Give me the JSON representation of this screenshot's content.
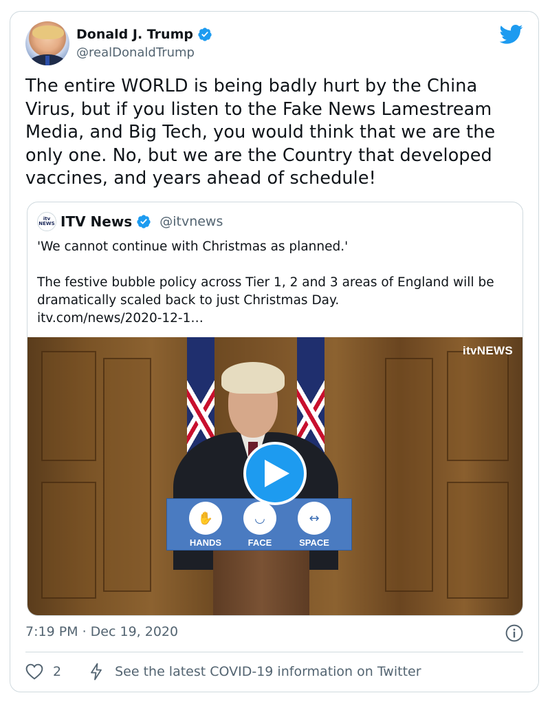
{
  "author": {
    "name": "Donald J. Trump",
    "handle": "@realDonaldTrump",
    "verified": true,
    "avatar": "profile-photo"
  },
  "tweet": {
    "text": "The entire WORLD is being badly hurt by the China Virus, but if you listen to the Fake News Lamestream Media, and Big Tech, you would think that we are the only one. No, but we are the Country that developed vaccines, and years ahead of schedule!"
  },
  "quote": {
    "avatar_text": "itv NEWS",
    "name": "ITV News",
    "handle": "@itvnews",
    "verified": true,
    "text": "'We cannot continue with Christmas as planned.'\n\nThe festive bubble policy across Tier 1, 2 and 3 areas of England will be dramatically scaled back to just Christmas Day.\nitv.com/news/2020-12-1…",
    "video": {
      "logo_text": "itvNEWS",
      "sign_labels": [
        "HANDS",
        "FACE",
        "SPACE"
      ],
      "play_icon": "play-icon"
    }
  },
  "meta": {
    "timestamp": "7:19 PM · Dec 19, 2020",
    "like_count": "2",
    "covid_link": "See the latest COVID-19 information on Twitter"
  },
  "colors": {
    "accent": "#1d9bf0",
    "text_secondary": "#536471",
    "border": "#cfd9de"
  }
}
